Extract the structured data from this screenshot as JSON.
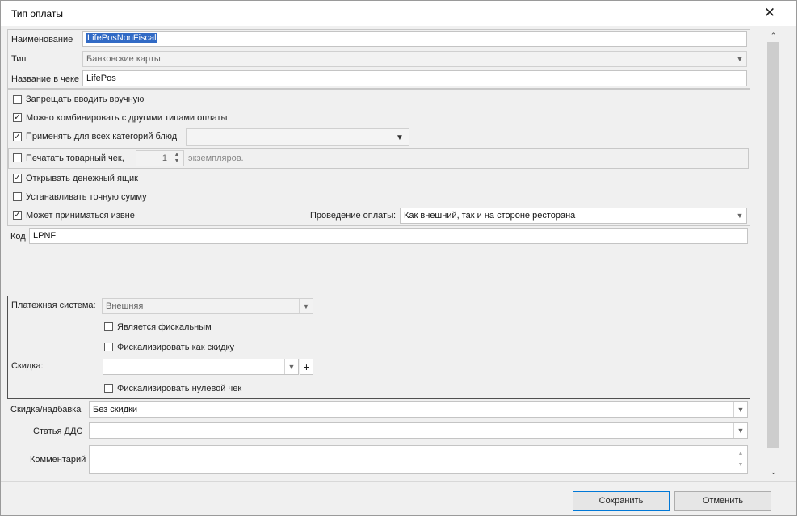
{
  "window": {
    "title": "Тип оплаты"
  },
  "fields": {
    "name_label": "Наименование",
    "name_value": "LifePosNonFiscal",
    "type_label": "Тип",
    "type_value": "Банковские карты",
    "receipt_label": "Название в чеке",
    "receipt_value": "LifePos"
  },
  "options": {
    "forbid_manual": {
      "label": "Запрещать вводить вручную",
      "checked": false
    },
    "combine": {
      "label": "Можно комбинировать с другими типами оплаты",
      "checked": true
    },
    "apply_all": {
      "label": "Применять для всех категорий блюд",
      "checked": true
    },
    "print_receipt": {
      "label": "Печатать товарный чек,",
      "checked": false,
      "copies": "1",
      "copies_suffix": "экземпляров."
    },
    "open_drawer": {
      "label": "Открывать денежный ящик",
      "checked": true
    },
    "exact_sum": {
      "label": "Устанавливать точную сумму",
      "checked": false
    },
    "external": {
      "label": "Может приниматься извне",
      "checked": true
    },
    "processing_label": "Проведение оплаты:",
    "processing_value": "Как внешний, так и на стороне ресторана"
  },
  "code": {
    "label": "Код",
    "value": "LPNF"
  },
  "payment": {
    "system_label": "Платежная система:",
    "system_value": "Внешняя",
    "fiscal": {
      "label": "Является фискальным",
      "checked": false
    },
    "fiscalize_discount": {
      "label": "Фискализировать как скидку",
      "checked": false
    },
    "discount_label": "Скидка:",
    "discount_value": "",
    "zero_receipt": {
      "label": "Фискализировать нулевой чек",
      "checked": false
    }
  },
  "bottom": {
    "discount_label": "Скидка/надбавка",
    "discount_value": "Без скидки",
    "dds_label": "Статья ДДС",
    "dds_value": "",
    "comment_label": "Комментарий",
    "comment_value": ""
  },
  "buttons": {
    "save": "Сохранить",
    "cancel": "Отменить"
  },
  "icons": {
    "close": "close-icon",
    "dropdown": "chevron-down-icon",
    "add": "plus-icon",
    "check": "checkmark-icon"
  }
}
